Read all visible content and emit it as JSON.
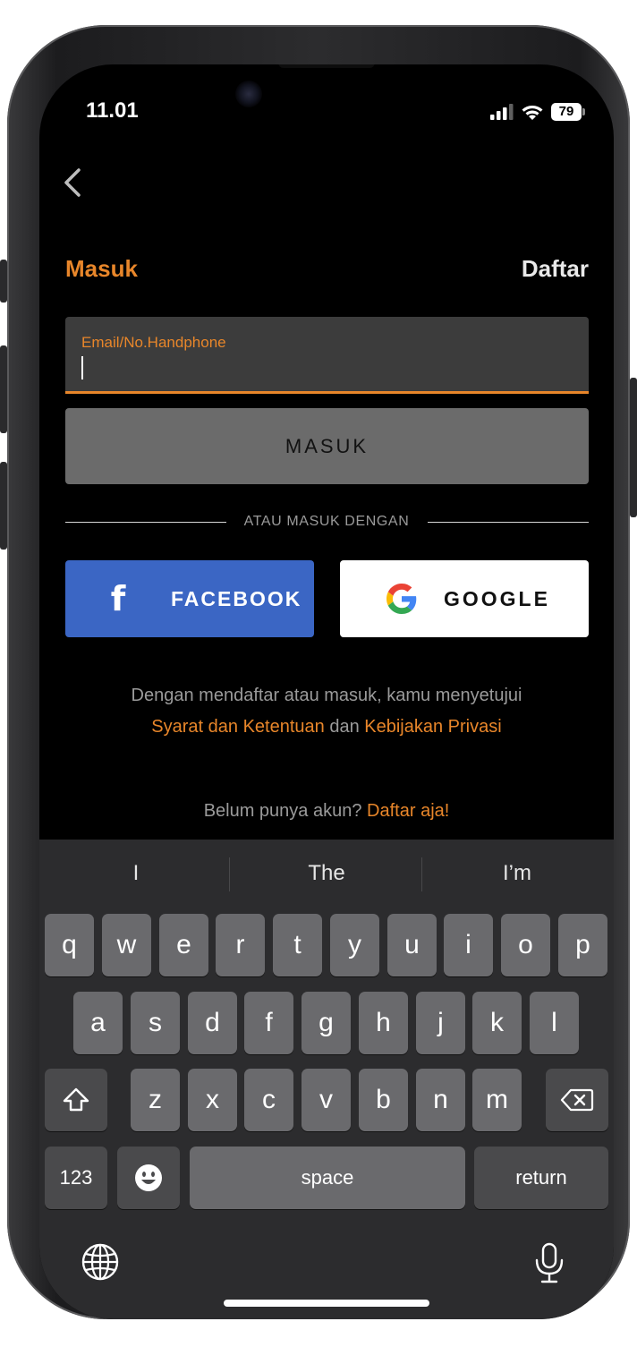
{
  "status_bar": {
    "time": "11.01",
    "battery": "79"
  },
  "header": {
    "tab_login": "Masuk",
    "tab_register": "Daftar"
  },
  "login_form": {
    "email_label": "Email/No.Handphone",
    "email_value": "",
    "submit_label": "MASUK"
  },
  "social": {
    "divider": "ATAU MASUK DENGAN",
    "facebook_label": "FACEBOOK",
    "google_label": "GOOGLE"
  },
  "terms": {
    "line1": "Dengan mendaftar atau masuk, kamu menyetujui",
    "terms_link": "Syarat dan Ketentuan",
    "and": "dan",
    "privacy_link": "Kebijakan Privasi"
  },
  "signup": {
    "prompt": "Belum punya akun?",
    "link": "Daftar aja!"
  },
  "keyboard": {
    "suggestions": [
      "I",
      "The",
      "I’m"
    ],
    "row1": [
      "q",
      "w",
      "e",
      "r",
      "t",
      "y",
      "u",
      "i",
      "o",
      "p"
    ],
    "row2": [
      "a",
      "s",
      "d",
      "f",
      "g",
      "h",
      "j",
      "k",
      "l"
    ],
    "row3": [
      "z",
      "x",
      "c",
      "v",
      "b",
      "n",
      "m"
    ],
    "numbers_key": "123",
    "space_key": "space",
    "return_key": "return"
  },
  "colors": {
    "accent": "#e8862a",
    "facebook": "#3b66c4",
    "background": "#000000",
    "keyboard_bg": "#2c2c2e"
  }
}
